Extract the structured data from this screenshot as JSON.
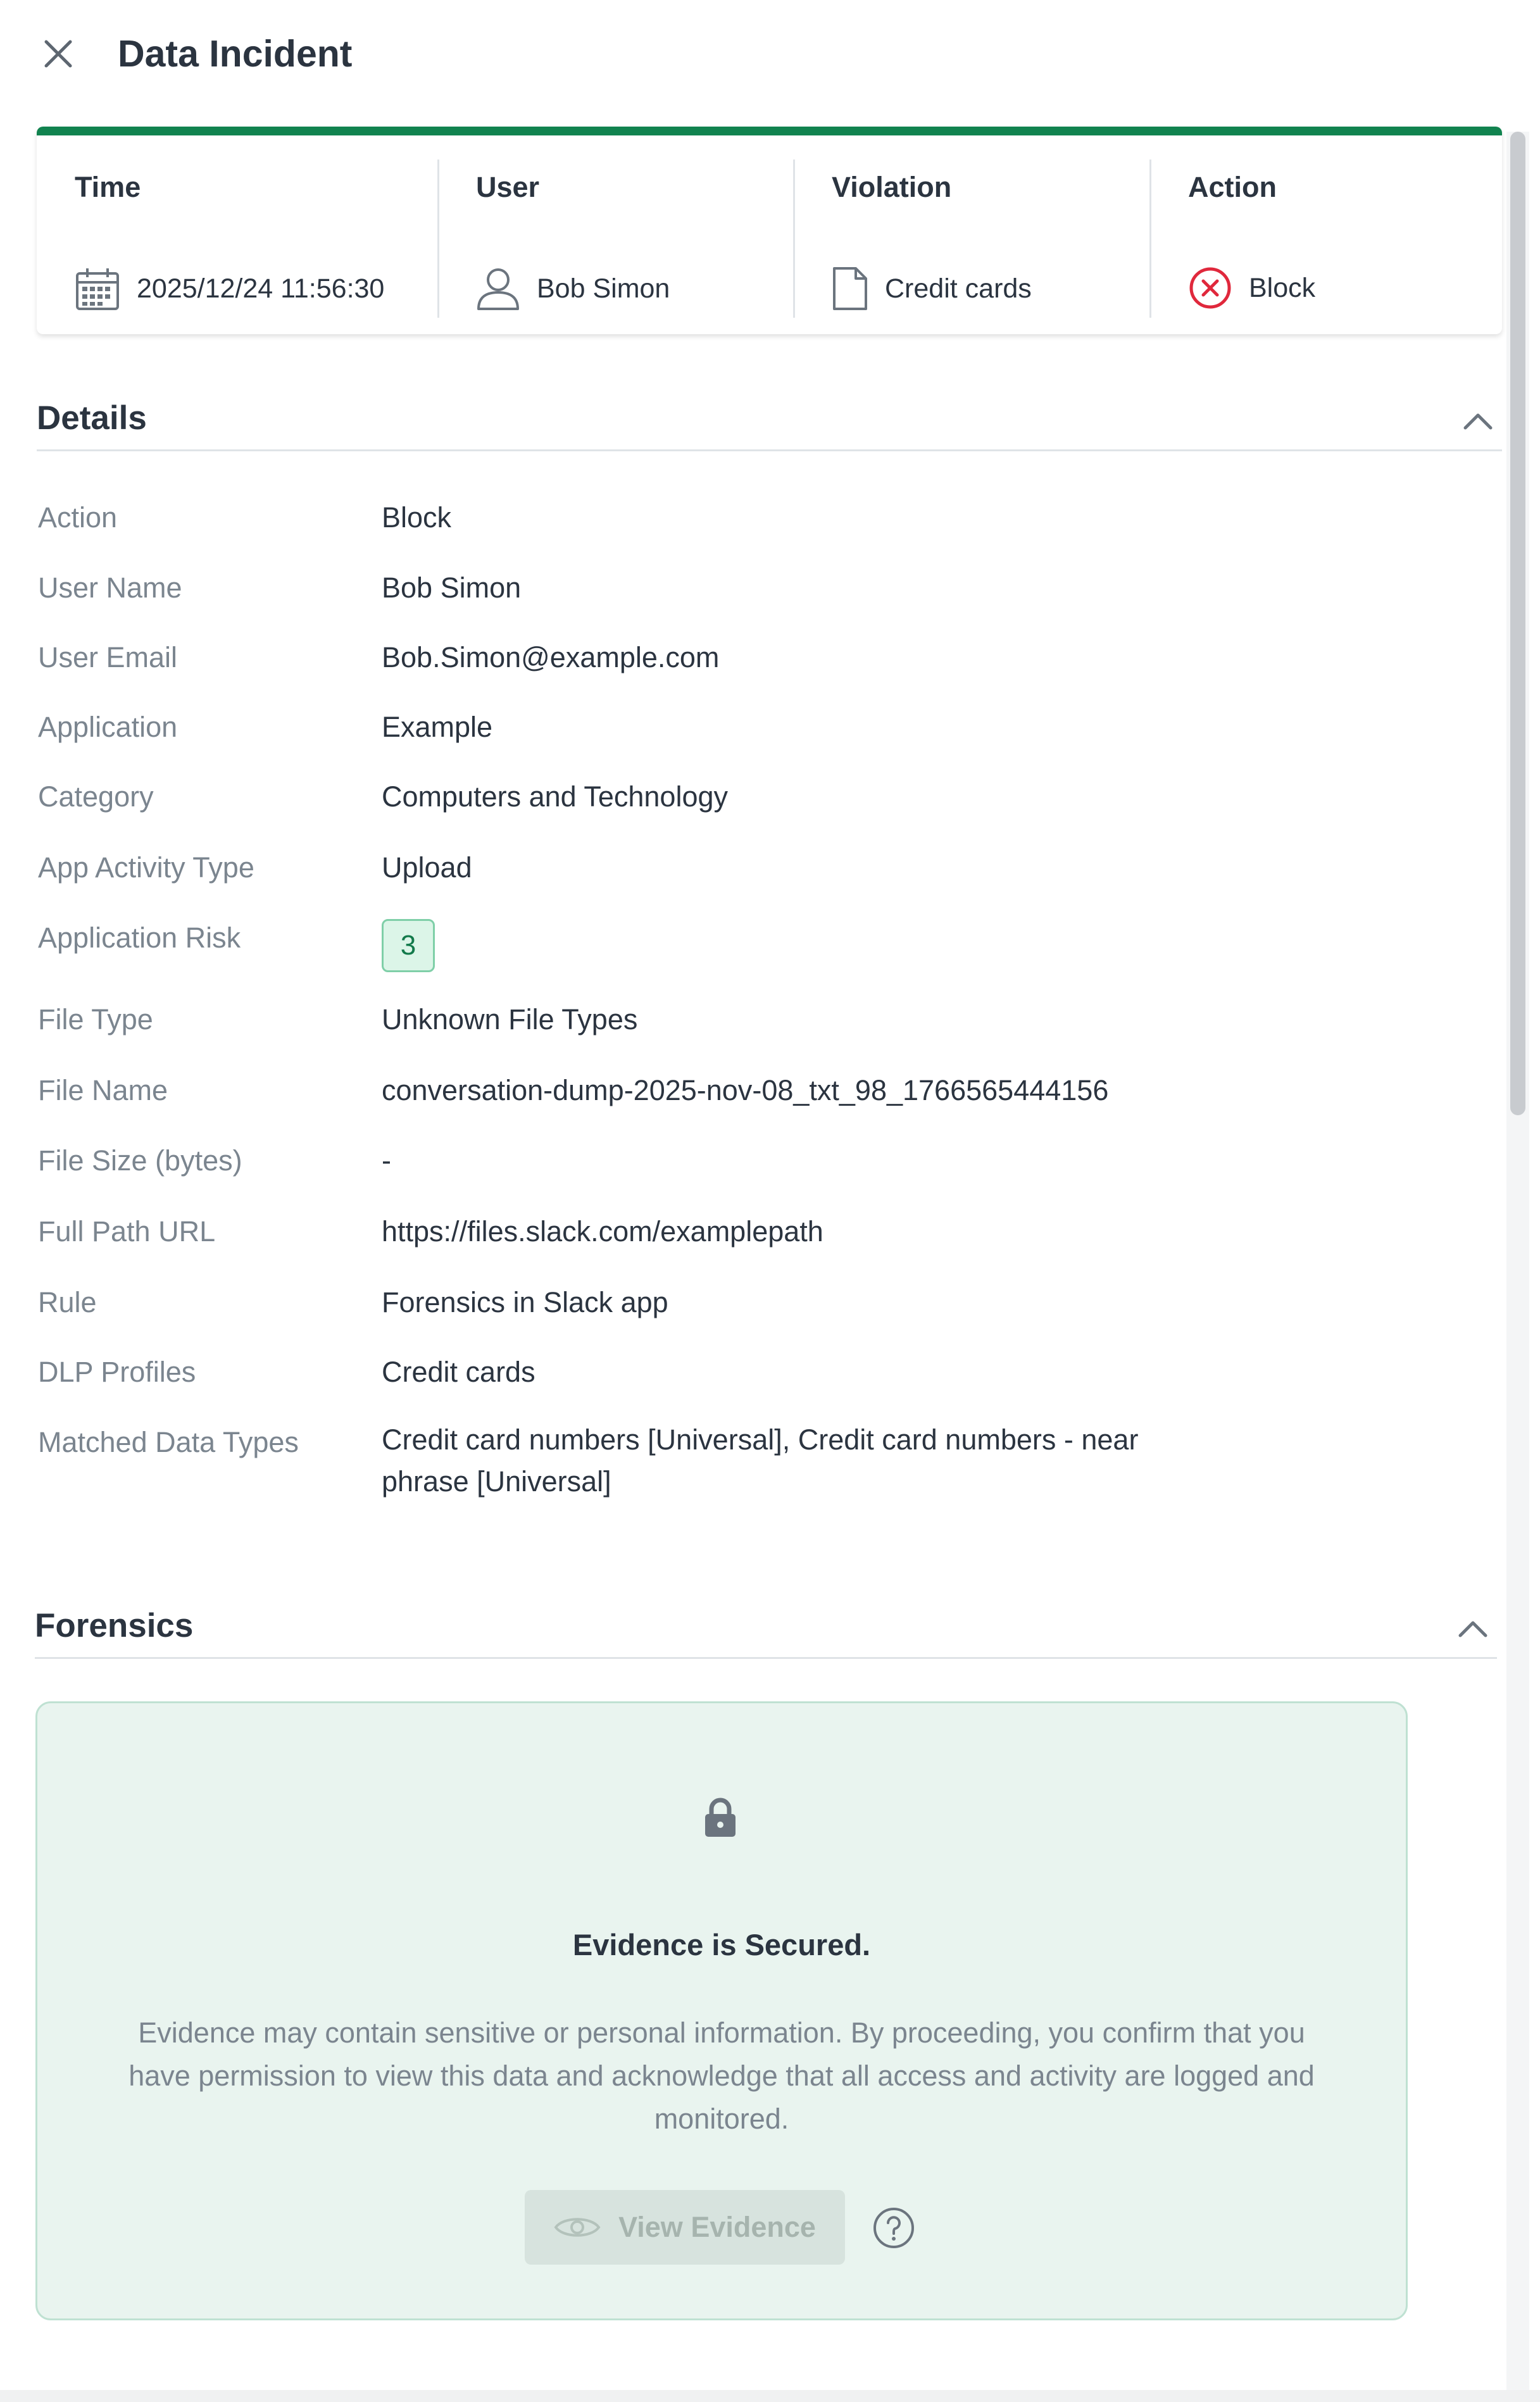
{
  "header": {
    "title": "Data Incident",
    "close_icon": "close-icon"
  },
  "summary": {
    "columns": [
      {
        "head": "Time",
        "value": "2025/12/24 11:56:30",
        "icon": "calendar-icon"
      },
      {
        "head": "User",
        "value": "Bob Simon",
        "icon": "user-icon"
      },
      {
        "head": "Violation",
        "value": "Credit cards",
        "icon": "file-icon"
      },
      {
        "head": "Action",
        "value": "Block",
        "icon": "block-icon"
      }
    ],
    "accent_color": "#11834f",
    "block_color": "#e0283c"
  },
  "details": {
    "title": "Details",
    "rows": [
      {
        "label": "Action",
        "value": "Block"
      },
      {
        "label": "User Name",
        "value": "Bob Simon"
      },
      {
        "label": "User Email",
        "value": "Bob.Simon@example.com"
      },
      {
        "label": "Application",
        "value": "Example"
      },
      {
        "label": "Category",
        "value": "Computers and Technology"
      },
      {
        "label": "App Activity Type",
        "value": "Upload"
      },
      {
        "label": "Application Risk",
        "value": "3"
      },
      {
        "label": "File Type",
        "value": "Unknown File Types"
      },
      {
        "label": "File Name",
        "value": "conversation-dump-2025-nov-08_txt_98_1766565444156"
      },
      {
        "label": "File Size (bytes)",
        "value": "-"
      },
      {
        "label": "Full Path URL",
        "value": "https://files.slack.com/examplepath"
      },
      {
        "label": "Rule",
        "value": "Forensics in Slack app"
      },
      {
        "label": "DLP Profiles",
        "value": "Credit cards"
      },
      {
        "label": "Matched Data Types",
        "value": "Credit card numbers [Universal], Credit card numbers - near phrase [Universal]"
      }
    ]
  },
  "forensics": {
    "title": "Forensics",
    "evidence_title": "Evidence is Secured.",
    "evidence_text": "Evidence may contain sensitive or personal information. By proceeding, you confirm that you have permission to view this data and acknowledge that all access and activity are logged and monitored.",
    "view_button": "View Evidence"
  }
}
